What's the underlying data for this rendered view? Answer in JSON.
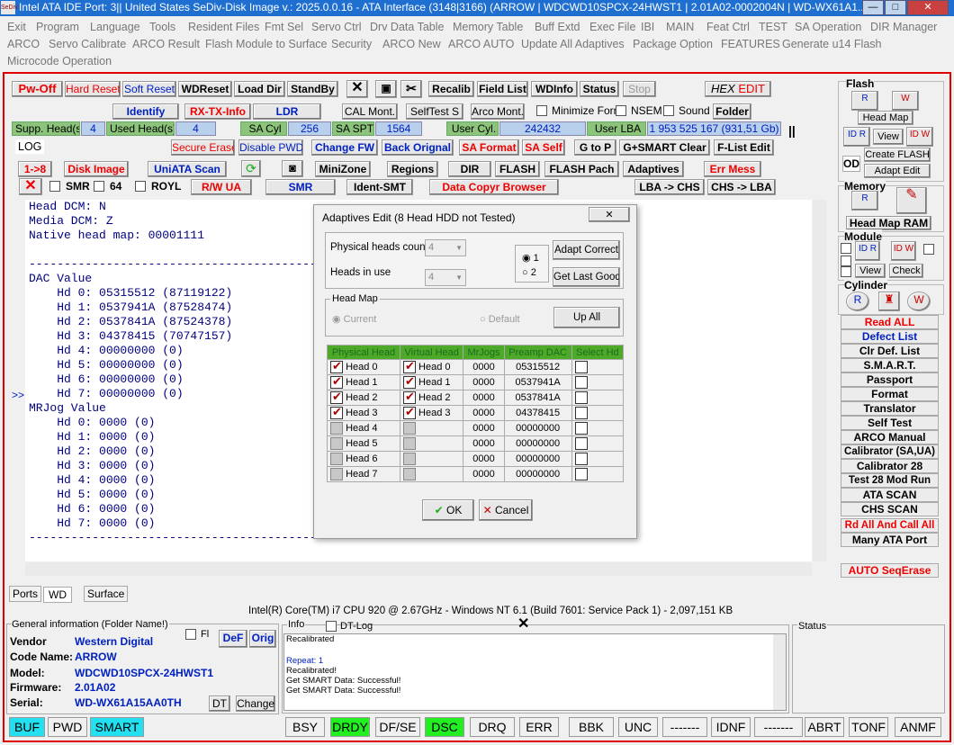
{
  "window": {
    "title": "Intel ATA IDE  Port: 3|| United States  SeDiv-Disk Image v.: 2025.0.0.16 - ATA Interface (3148|3166)  (ARROW | WDCWD10SPCX-24HWST1 | 2.01A02-0002004N | WD-WX61A1...",
    "icon": "SeDiv",
    "min": "—",
    "max": "□",
    "close": "✕"
  },
  "menu": [
    "Exit",
    "Program",
    "Language",
    "Tools",
    "Resident Files",
    "Fmt Sel",
    "Servo Ctrl",
    "Drv Data Table",
    "Memory Table",
    "Buff Extd",
    "Exec File",
    "IBI",
    "MAIN",
    "Feat Ctrl",
    "TEST",
    "SA Operation",
    "DIR Manager",
    "ARCO",
    "Servo Calibrate",
    "ARCO Result",
    "Flash Module to Surface",
    "Security",
    "ARCO New",
    "ARCO AUTO",
    "Update All Adaptives",
    "Package Option",
    "FEATURES",
    "Generate u14 Flash",
    "Microcode Operation"
  ],
  "toolbar": {
    "pwoff": "Pw-Off",
    "hard_reset": "Hard Reset",
    "soft_reset": "Soft Reset",
    "wdreset": "WDReset",
    "load_dir": "Load Dir",
    "standby": "StandBy",
    "recalib": "Recalib",
    "field_list": "Field List",
    "wdinfo": "WDInfo",
    "status": "Status",
    "stop": "Stop",
    "hex_edit_a": "HEX",
    "hex_edit_b": "EDIT",
    "identify": "Identify",
    "rxtx": "RX-TX-Info",
    "ldr": "LDR",
    "cal_mont": "CAL Mont.",
    "selftest": "SelfTest S",
    "arco_mont": "Arco Mont.",
    "minimize_form": "Minimize Form",
    "nsem": "NSEM",
    "sound": "Sound",
    "folder": "Folder",
    "supp_heads_label": "Supp. Head(s)",
    "supp_heads": "4",
    "used_heads_label": "Used Head(s)",
    "used_heads": "4",
    "sa_cyl_label": "SA Cyl",
    "sa_cyl": "256",
    "sa_spt_label": "SA SPT",
    "sa_spt": "1564",
    "user_cyl_label": "User Cyl.",
    "user_cyl": "242432",
    "user_lba_label": "User LBA",
    "user_lba": "1 953 525 167  (931,51 Gb)",
    "pause": "||",
    "log_tab": "LOG",
    "secure_erase": "Secure Erase",
    "disable_pwd": "Disable PWD",
    "change_fw": "Change FW",
    "back_orig": "Back Orignal",
    "sa_format": "SA Format",
    "sa_self": "SA Self",
    "g_to_p": "G to P",
    "gsmart": "G+SMART Clear",
    "flist": "F-List Edit",
    "one_to_eight": "1->8",
    "disk_image": "Disk Image",
    "uniata": "UniATA Scan",
    "minizone": "MiniZone",
    "regions": "Regions",
    "dir": "DIR",
    "flash": "FLASH",
    "flash_pach": "FLASH Pach",
    "adaptives": "Adaptives",
    "err_mess": "Err Mess",
    "smr_chk": "SMR",
    "b64": "64",
    "royl": "ROYL",
    "rw_ua": "R/W UA",
    "smr": "SMR",
    "ident_smt": "Ident-SMT",
    "data_copyr": "Data Copyr Browser",
    "lba_chs": "LBA -> CHS",
    "chs_lba": "CHS -> LBA"
  },
  "log_lines": [
    "Head DCM: N",
    "Media DCM: Z",
    "Native head map: 00001111",
    "",
    "-------------------------------------------",
    "DAC Value",
    "    Hd 0: 05315512 (87119122)",
    "    Hd 1: 0537941A (87528474)",
    "    Hd 2: 0537841A (87524378)",
    "    Hd 3: 04378415 (70747157)",
    "    Hd 4: 00000000 (0)",
    "    Hd 5: 00000000 (0)",
    "    Hd 6: 00000000 (0)",
    "    Hd 7: 00000000 (0)",
    "MRJog Value",
    "    Hd 0: 0000 (0)",
    "    Hd 1: 0000 (0)",
    "    Hd 2: 0000 (0)",
    "    Hd 3: 0000 (0)",
    "    Hd 4: 0000 (0)",
    "    Hd 5: 0000 (0)",
    "    Hd 6: 0000 (0)",
    "    Hd 7: 0000 (0)",
    "-------------------------------------------"
  ],
  "log_expand": ">>",
  "side": {
    "flash": "Flash",
    "head_map": "Head Map",
    "view": "View",
    "create_flash": "Create FLASH",
    "adapt_edit": "Adapt Edit",
    "od": "OD",
    "memory": "Memory",
    "head_map_ram": "Head Map RAM",
    "module": "Module",
    "view2": "View",
    "check": "Check",
    "cylinder": "Cylinder",
    "buttons": [
      "Read ALL",
      "Defect List",
      "Clr Def. List",
      "S.M.A.R.T.",
      "Passport",
      "Format",
      "Translator",
      "Self Test",
      "ARCO Manual",
      "Calibrator (SA,UA)",
      "Calibrator 28",
      "Test 28 Mod Run",
      "ATA SCAN",
      "CHS SCAN",
      "Rd All And Call All",
      "Many ATA Port"
    ],
    "auto_seq": "AUTO SeqErase"
  },
  "dialog": {
    "title": "Adaptives Edit (8 Head  HDD not Tested)",
    "close": "✕",
    "phys_label": "Physical heads count",
    "phys_val": "4",
    "inuse_label": "Heads in use",
    "inuse_val": "4",
    "radio1": "1",
    "radio2": "2",
    "adapt_correct": "Adapt Correct",
    "get_last_good": "Get Last Good",
    "headmap_group": "Head Map",
    "current": "Current",
    "default": "Default",
    "up_all": "Up All",
    "cols": [
      "Physical Head",
      "Virtual Head",
      "MrJogs",
      "Preamp DAC",
      "Select Hd"
    ],
    "rows": [
      {
        "p": "Head 0",
        "v": "Head 0",
        "mr": "0000",
        "dac": "05315512",
        "on": true
      },
      {
        "p": "Head 1",
        "v": "Head 1",
        "mr": "0000",
        "dac": "0537941A",
        "on": true
      },
      {
        "p": "Head 2",
        "v": "Head 2",
        "mr": "0000",
        "dac": "0537841A",
        "on": true
      },
      {
        "p": "Head 3",
        "v": "Head 3",
        "mr": "0000",
        "dac": "04378415",
        "on": true
      },
      {
        "p": "Head 4",
        "v": "",
        "mr": "0000",
        "dac": "00000000",
        "on": false
      },
      {
        "p": "Head 5",
        "v": "",
        "mr": "0000",
        "dac": "00000000",
        "on": false
      },
      {
        "p": "Head 6",
        "v": "",
        "mr": "0000",
        "dac": "00000000",
        "on": false
      },
      {
        "p": "Head 7",
        "v": "",
        "mr": "0000",
        "dac": "00000000",
        "on": false
      }
    ],
    "ok": "OK",
    "cancel": "Cancel"
  },
  "tabs": [
    "Ports",
    "WD",
    "Surface"
  ],
  "cpu": "Intel(R) Core(TM) i7 CPU 920  @ 2.67GHz - Windows NT 6.1 (Build 7601: Service Pack 1) - 2,097,151 KB",
  "general": {
    "title": "General information (Folder Name!)",
    "fl": "Fl",
    "def": "DeF",
    "orig": "Orig",
    "dt": "DT",
    "change": "Change",
    "vendor_l": "Vendor",
    "vendor": "Western Digital",
    "code_l": "Code Name:",
    "code": "ARROW",
    "model_l": "Model:",
    "model": "WDCWD10SPCX-24HWST1",
    "fw_l": "Firmware:",
    "fw": "2.01A02",
    "serial_l": "Serial:",
    "serial": "WD-WX61A15AA0TH"
  },
  "info": {
    "title": "Info",
    "dtlog": "DT-Log",
    "lines": [
      "Recalibrated",
      "",
      "Repeat: 1",
      "Recalibrated!",
      "Get SMART Data: Successful!",
      "Get SMART Data: Successful!"
    ]
  },
  "status_title": "Status",
  "status_bar": [
    "BUF",
    "PWD",
    "SMART",
    "BSY",
    "DRDY",
    "DF/SE",
    "DSC",
    "DRQ",
    "ERR",
    "BBK",
    "UNC",
    "-------",
    "IDNF",
    "-------",
    "ABRT",
    "TONF",
    "ANMF"
  ],
  "colors": {
    "accent_red": "#e00000",
    "green_cell": "#8bc47a",
    "cyan": "#22e0f0",
    "lime": "#22ee22"
  }
}
